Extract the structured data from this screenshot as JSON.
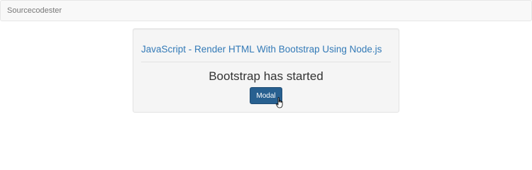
{
  "navbar": {
    "brand": "Sourcecodester"
  },
  "main": {
    "heading": "JavaScript - Render HTML With Bootstrap Using Node.js",
    "status_text": "Bootstrap has started",
    "modal_button_label": "Modal"
  },
  "icons": {
    "cursor": "hand-pointer-icon"
  },
  "colors": {
    "link": "#337ab7",
    "button_bg": "#286090",
    "navbar_bg": "#f8f8f8",
    "well_bg": "#f5f5f5"
  }
}
